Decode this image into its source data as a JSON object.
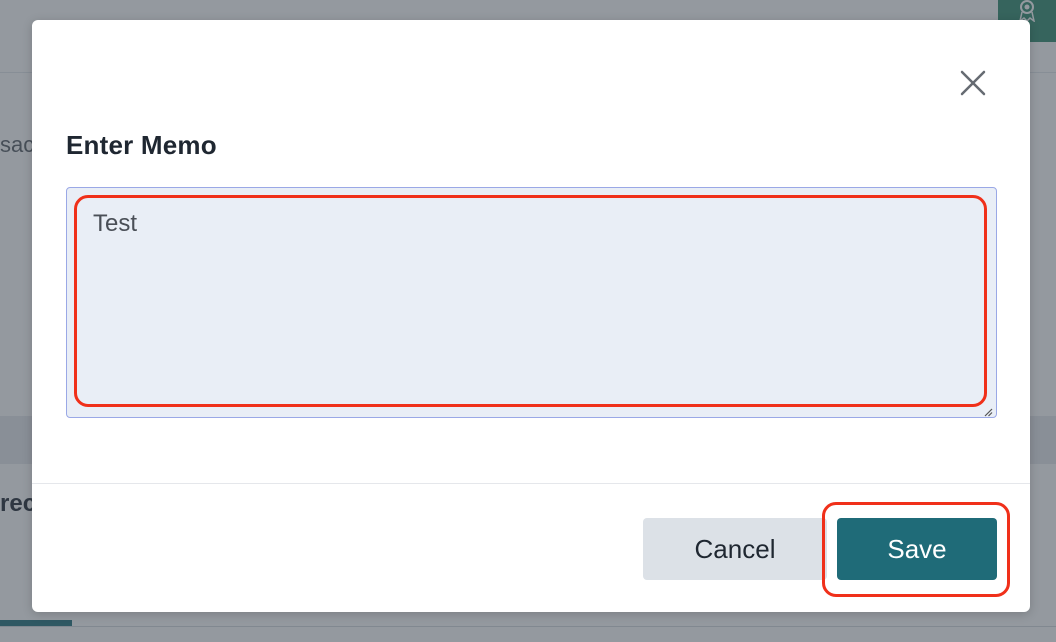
{
  "background": {
    "partial_text_1": "sac",
    "partial_text_2": "rec",
    "award_icon": "award-icon"
  },
  "modal": {
    "title": "Enter Memo",
    "close_icon": "close-icon",
    "memo": {
      "value": "Test",
      "placeholder": ""
    },
    "buttons": {
      "cancel_label": "Cancel",
      "save_label": "Save"
    }
  },
  "colors": {
    "overlay": "#3c4650",
    "primary": "#1f6b78",
    "highlight": "#f0301a",
    "field_bg": "#e9eef6",
    "field_border": "#9aa8e6",
    "secondary_button": "#dce1e7",
    "award_badge": "#2f8a6e"
  }
}
